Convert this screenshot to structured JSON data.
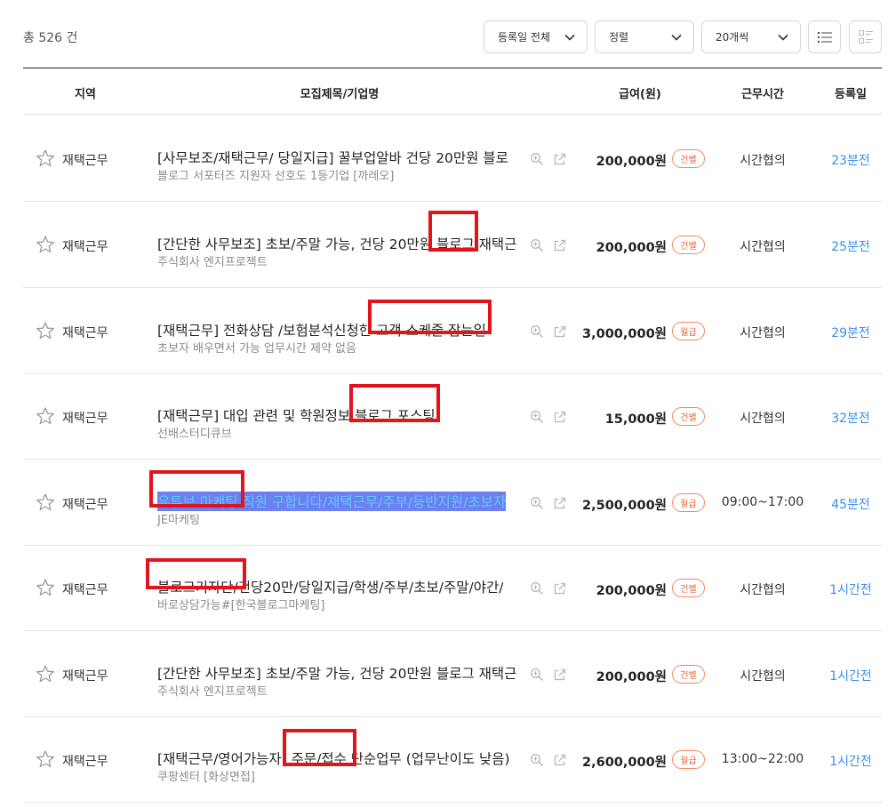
{
  "toolbar": {
    "total_label": "총 526 건",
    "date_filter": "등록일 전체",
    "sort_filter": "정렬",
    "page_size": "20개씩"
  },
  "table": {
    "headers": {
      "region": "지역",
      "title": "모집제목/기업명",
      "pay": "급여(원)",
      "hours": "근무시간",
      "posted": "등록일"
    }
  },
  "rows": [
    {
      "region": "재택근무",
      "title": "[사무보조/재택근무/ 당일지급] 꿀부업알바 건당 20만원 블로",
      "company": "블로그 서포터즈 지원자 선호도 1등기업 [까레오]",
      "pay": "200,000원",
      "badge": "건별",
      "hours": "시간협의",
      "posted": "23분전"
    },
    {
      "region": "재택근무",
      "title": "[간단한 사무보조] 초보/주말 가능, 건당 20만원 블로그 재택근",
      "company": "주식회사 엔지프로젝트",
      "pay": "200,000원",
      "badge": "건별",
      "hours": "시간협의",
      "posted": "25분전"
    },
    {
      "region": "재택근무",
      "title": "[재택근무] 전화상담 /보험분석신청한 고객 스케줄 잡는일",
      "company": "초보자 배우면서 가능 업무시간 제약 없음",
      "pay": "3,000,000원",
      "badge": "월급",
      "hours": "시간협의",
      "posted": "29분전"
    },
    {
      "region": "재택근무",
      "title": "[재택근무] 대입 관련 및 학원정보 블로그 포스팅",
      "company": "선배스터디큐브",
      "pay": "15,000원",
      "badge": "건별",
      "hours": "시간협의",
      "posted": "32분전"
    },
    {
      "region": "재택근무",
      "title": "유튜브 마케팅 직원 구합니다/재택근무/주부/등반지원/초보자",
      "company": "JE마케팅",
      "pay": "2,500,000원",
      "badge": "월급",
      "hours": "09:00~17:00",
      "posted": "45분전"
    },
    {
      "region": "재택근무",
      "title": "블로그기자단/건당20만/당일지급/학생/주부/초보/주말/야간/",
      "company": "바로상담가능#[한국블로그마케팅]",
      "pay": "200,000원",
      "badge": "건별",
      "hours": "시간협의",
      "posted": "1시간전"
    },
    {
      "region": "재택근무",
      "title": "[간단한 사무보조] 초보/주말 가능, 건당 20만원 블로그 재택근",
      "company": "주식회사 엔지프로젝트",
      "pay": "200,000원",
      "badge": "건별",
      "hours": "시간협의",
      "posted": "1시간전"
    },
    {
      "region": "재택근무",
      "title": "[재택근무/영어가능자] 주문/접수 단순업무 (업무난이도 낮음)",
      "company": "쿠팡센터 [화상면접]",
      "pay": "2,600,000원",
      "badge": "월급",
      "hours": "13:00~22:00",
      "posted": "1시간전"
    }
  ],
  "colors": {
    "accent_blue": "#3a8ee6",
    "badge_orange": "#e8643a",
    "highlight_red": "#e3131b",
    "selection": "#6e7ff0"
  }
}
